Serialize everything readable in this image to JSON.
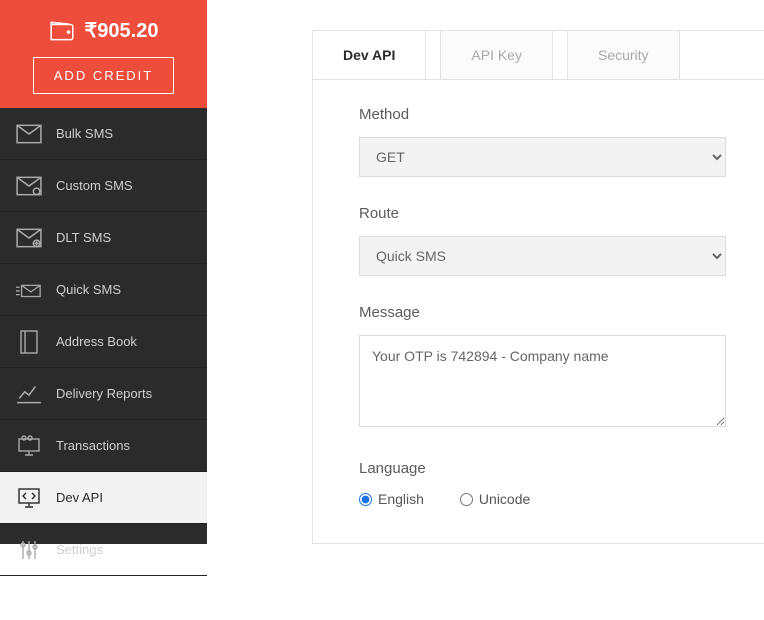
{
  "wallet": {
    "balance": "₹905.20",
    "add_credit": "ADD CREDIT"
  },
  "sidebar": {
    "items": [
      {
        "label": "Bulk SMS"
      },
      {
        "label": "Custom SMS"
      },
      {
        "label": "DLT SMS"
      },
      {
        "label": "Quick SMS"
      },
      {
        "label": "Address Book"
      },
      {
        "label": "Delivery Reports"
      },
      {
        "label": "Transactions"
      },
      {
        "label": "Dev API"
      },
      {
        "label": "Settings"
      }
    ]
  },
  "tabs": {
    "dev_api": "Dev API",
    "api_key": "API Key",
    "security": "Security"
  },
  "form": {
    "method_label": "Method",
    "method_value": "GET",
    "route_label": "Route",
    "route_value": "Quick SMS",
    "message_label": "Message",
    "message_value": "Your OTP is 742894 - Company name",
    "language_label": "Language",
    "language_english": "English",
    "language_unicode": "Unicode"
  }
}
